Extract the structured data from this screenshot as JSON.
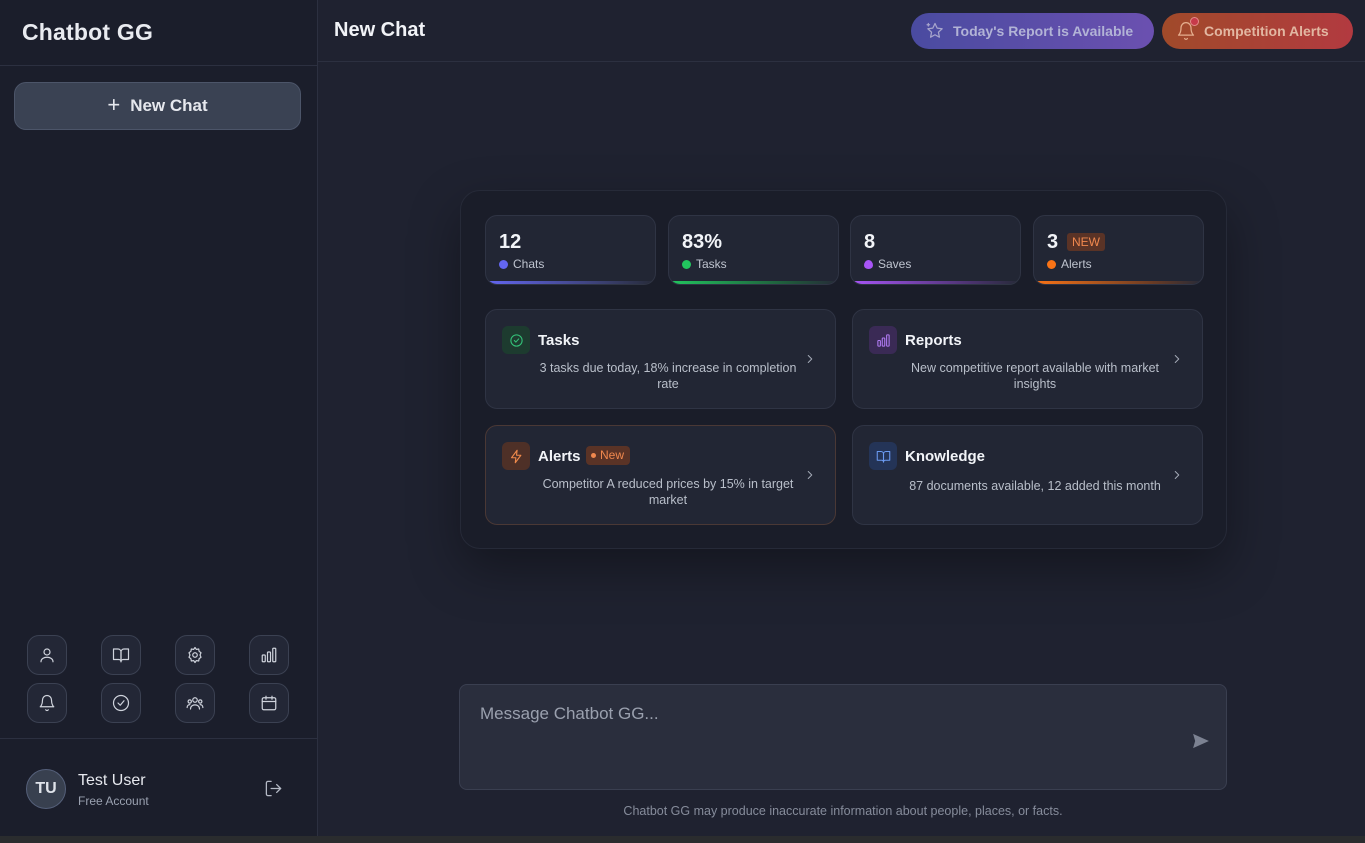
{
  "sidebar": {
    "brand": "Chatbot GG",
    "new_chat_label": "New Chat",
    "icons": [
      "user-icon",
      "book-icon",
      "gear-icon",
      "bar-chart-icon",
      "bell-icon",
      "check-circle-icon",
      "users-icon",
      "calendar-icon"
    ],
    "user": {
      "initials": "TU",
      "name": "Test User",
      "plan": "Free Account"
    }
  },
  "header": {
    "title": "New Chat",
    "report_pill": "Today's Report is Available",
    "alerts_pill": "Competition Alerts"
  },
  "stats": [
    {
      "value": "12",
      "label": "Chats",
      "color": "#6366f1"
    },
    {
      "value": "83%",
      "label": "Tasks",
      "color": "#22c55e"
    },
    {
      "value": "8",
      "label": "Saves",
      "color": "#a855f7"
    },
    {
      "value": "3",
      "label": "Alerts",
      "color": "#f97316",
      "badge": "NEW"
    }
  ],
  "features": [
    {
      "title": "Tasks",
      "desc": "3 tasks due today, 18% increase in completion rate",
      "icon": "check-circle-icon"
    },
    {
      "title": "Reports",
      "desc": "New competitive report available with market insights",
      "icon": "bar-chart-icon"
    },
    {
      "title": "Alerts",
      "desc": "Competitor A reduced prices by 15% in target market",
      "icon": "lightning-icon",
      "tag": "New"
    },
    {
      "title": "Knowledge",
      "desc": "87 documents available, 12 added this month",
      "icon": "book-icon"
    }
  ],
  "composer": {
    "placeholder": "Message Chatbot GG..."
  },
  "disclaimer": "Chatbot GG may produce inaccurate information about people, places, or facts.",
  "colors": {
    "background": "#1f2230",
    "sidebar": "#1b1e2b",
    "card": "#222634"
  }
}
